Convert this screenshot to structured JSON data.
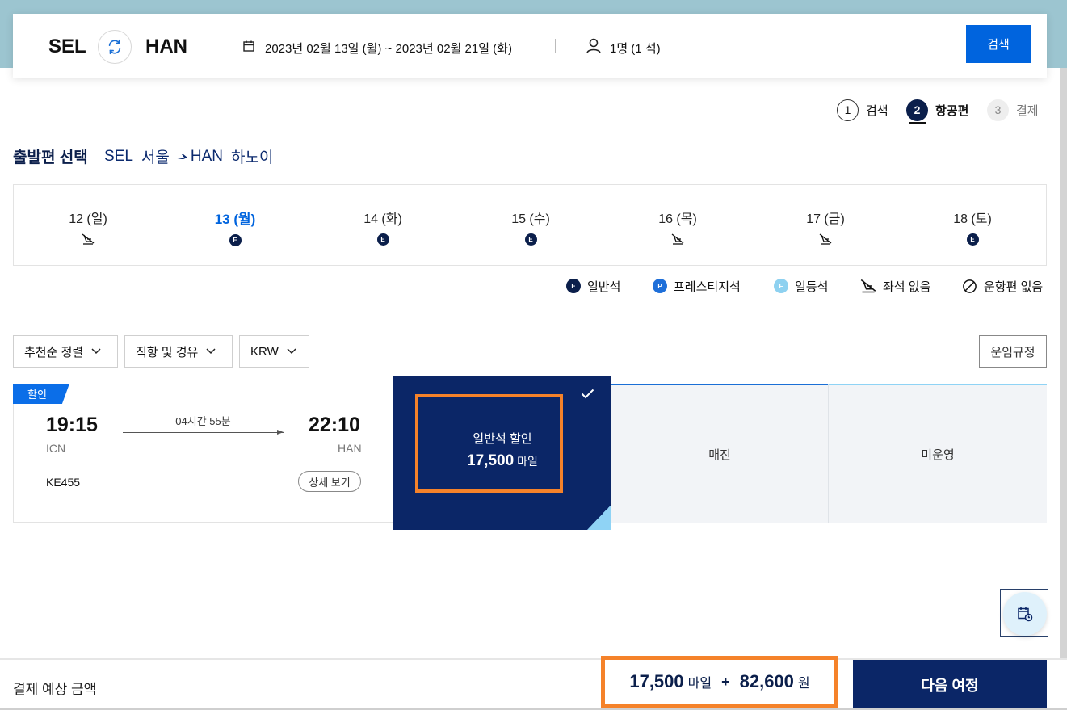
{
  "search": {
    "origin": "SEL",
    "destination": "HAN",
    "dates": "2023년 02월 13일 (월) ~ 2023년 02월 21일 (화)",
    "passengers": "1명 (1 석)",
    "search_label": "검색"
  },
  "steps": [
    {
      "num": "1",
      "label": "검색"
    },
    {
      "num": "2",
      "label": "항공편"
    },
    {
      "num": "3",
      "label": "결제"
    }
  ],
  "departure": {
    "title": "출발편 선택",
    "from_code": "SEL",
    "from_city": "서울",
    "to_code": "HAN",
    "to_city": "하노이"
  },
  "date_strip": [
    {
      "label": "12 (일)",
      "mark": "no-seat"
    },
    {
      "label": "13 (월)",
      "mark": "E"
    },
    {
      "label": "14 (화)",
      "mark": "E"
    },
    {
      "label": "15 (수)",
      "mark": "E"
    },
    {
      "label": "16 (목)",
      "mark": "no-seat"
    },
    {
      "label": "17 (금)",
      "mark": "no-seat"
    },
    {
      "label": "18 (토)",
      "mark": "E"
    }
  ],
  "legend": {
    "economy_badge": "E",
    "economy": "일반석",
    "prestige_badge": "P",
    "prestige": "프레스티지석",
    "first_badge": "F",
    "first": "일등석",
    "no_seat": "좌석 없음",
    "no_flight": "운항편 없음"
  },
  "filters": {
    "sort": "추천순 정렬",
    "stops": "직항 및 경유",
    "currency": "KRW",
    "fare_rules": "운임규정"
  },
  "flight": {
    "tag": "할인",
    "dep_time": "19:15",
    "dep_code": "ICN",
    "duration": "04시간 55분",
    "arr_time": "22:10",
    "arr_code": "HAN",
    "flight_no": "KE455",
    "detail_label": "상세 보기"
  },
  "fares": {
    "selected_name": "일반석 할인",
    "selected_price": "17,500",
    "selected_unit": "마일",
    "col2": "매진",
    "col3": "미운영"
  },
  "footer": {
    "label": "결제 예상 금액",
    "miles": "17,500",
    "miles_unit": "마일",
    "plus": "+",
    "won": "82,600",
    "won_unit": "원",
    "next_label": "다음 여정"
  },
  "colors": {
    "navy": "#0b2667",
    "accent_blue": "#0064de",
    "highlight_orange": "#f5822a"
  }
}
